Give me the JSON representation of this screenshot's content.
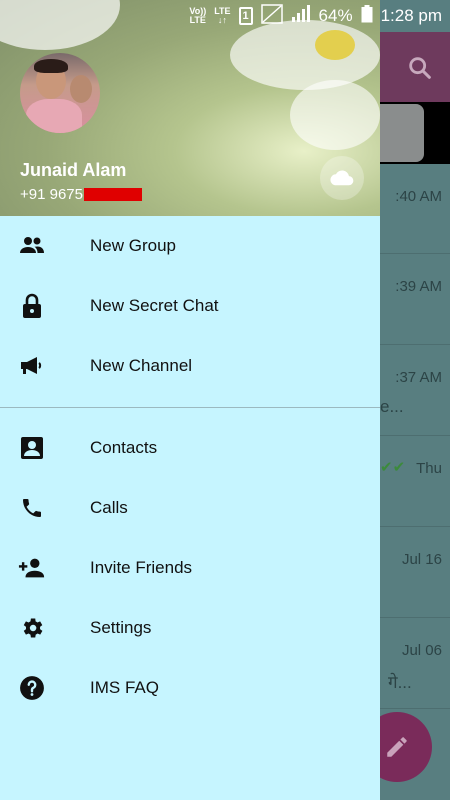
{
  "status_bar": {
    "volte_line1": "Vo))",
    "volte_line2": "LTE",
    "lte_line1": "LTE",
    "lte_line2": "↓↑",
    "sim": "1",
    "battery_percent": "64%",
    "time": "1:28 pm"
  },
  "drawer": {
    "user_name": "Junaid Alam",
    "user_phone_visible": "+91 9675",
    "menu_group_1": [
      {
        "label": "New Group",
        "icon": "group-icon"
      },
      {
        "label": "New Secret Chat",
        "icon": "lock-icon"
      },
      {
        "label": "New Channel",
        "icon": "megaphone-icon"
      }
    ],
    "menu_group_2": [
      {
        "label": "Contacts",
        "icon": "contact-card-icon"
      },
      {
        "label": "Calls",
        "icon": "phone-icon"
      },
      {
        "label": "Invite Friends",
        "icon": "add-person-icon"
      },
      {
        "label": "Settings",
        "icon": "gear-icon"
      },
      {
        "label": "IMS FAQ",
        "icon": "help-icon"
      }
    ]
  },
  "background_chats": [
    {
      "time": ":40 AM",
      "sub": ""
    },
    {
      "time": ":39 AM",
      "sub": ""
    },
    {
      "time": ":37 AM",
      "sub": "e..."
    },
    {
      "time": "Thu",
      "sub": ""
    },
    {
      "time": "Jul 16",
      "sub": ""
    },
    {
      "time": "Jul 06",
      "sub": "गे..."
    }
  ],
  "colors": {
    "drawer_bg": "#c6f5ff",
    "topbar": "#6e3a5d",
    "fab": "#7a2b5a",
    "redaction": "#e00000"
  }
}
